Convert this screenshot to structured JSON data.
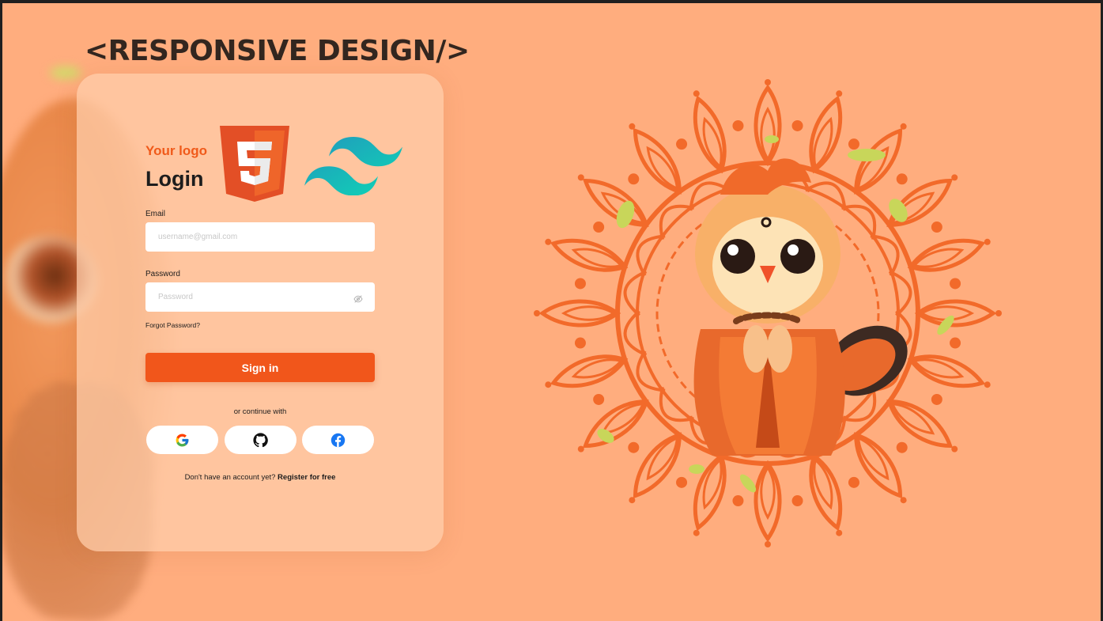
{
  "headline": "<RESPONSIVE DESIGN/>",
  "card": {
    "logo_text": "Your logo",
    "title": "Login",
    "email": {
      "label": "Email",
      "placeholder": "username@gmail.com"
    },
    "password": {
      "label": "Password",
      "placeholder": "Password"
    },
    "forgot_password": "Forgot Password?",
    "sign_in": "Sign in",
    "continue_with": "or continue with",
    "no_account": "Don't have an account yet?",
    "register": "Register for free"
  },
  "colors": {
    "background": "#ffad7e",
    "accent": "#f1561b",
    "logo": "#f05a1a"
  },
  "icons": [
    "html5-logo-icon",
    "tailwind-logo-icon",
    "eye-icon",
    "google-icon",
    "github-icon",
    "facebook-icon"
  ]
}
